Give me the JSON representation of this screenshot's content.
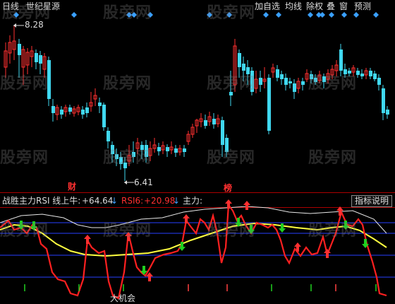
{
  "header": {
    "period": "日线",
    "indicator": "世纪星源",
    "buttons": [
      "加自选",
      "均线",
      "除权",
      "叠",
      "窗",
      "预测"
    ]
  },
  "upper_chart": {
    "high_label": "8.28",
    "low_label": "6.41",
    "marker_cai": "财",
    "marker_bang": "榜"
  },
  "lower_panel": {
    "title": "战胜主力RSI 线上牛:",
    "value1": "+64.64",
    "arrow1": "↓",
    "rsi_label": "RSI6:",
    "rsi_value": "+20.98",
    "arrow2": "↓",
    "main_label": "主力:",
    "help_button": "指标说明",
    "bottom_text": "大机会"
  },
  "watermark": "股旁网",
  "colors": {
    "up": "#ff3030",
    "down": "#40d8f0",
    "white_line": "#e8e8e8",
    "yellow_line": "#ffff40",
    "red_line": "#ff2020",
    "blue_line": "#3050ff",
    "diamond": "#3aa0ff",
    "green_arrow": "#20d020"
  }
}
